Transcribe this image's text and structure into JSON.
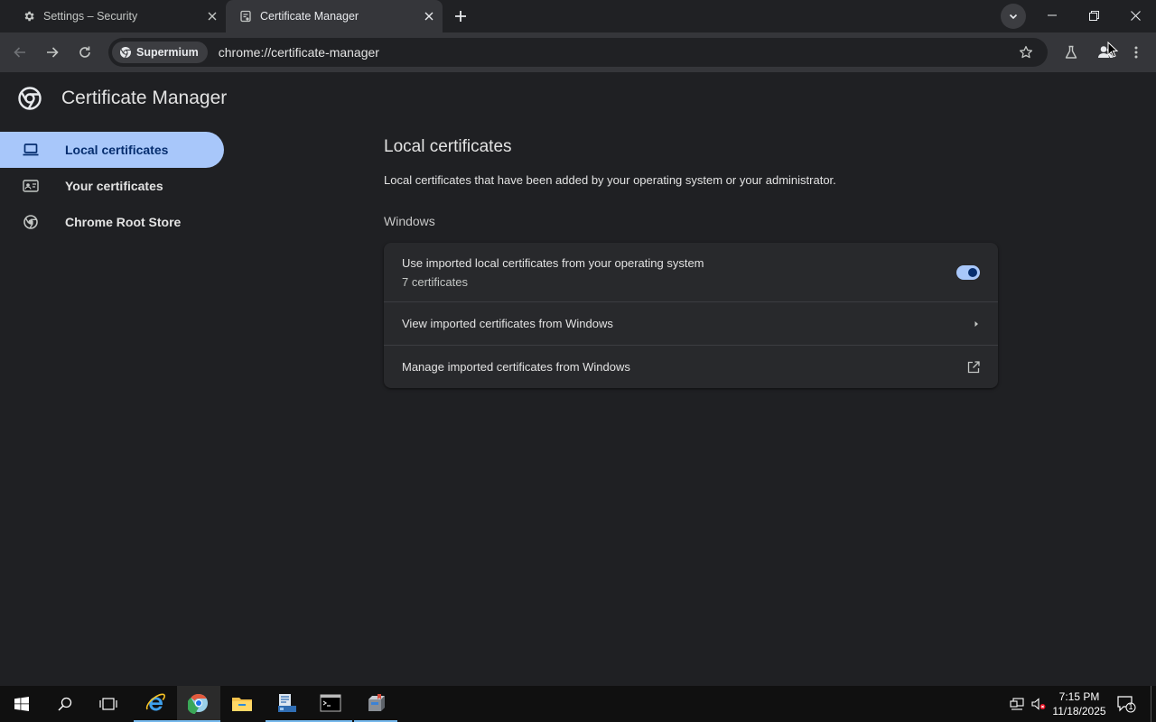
{
  "tabs": [
    {
      "title": "Settings – Security",
      "icon": "gear-icon"
    },
    {
      "title": "Certificate Manager",
      "icon": "certificate-icon",
      "active": true
    }
  ],
  "toolbar": {
    "chip_label": "Supermium",
    "url": "chrome://certificate-manager"
  },
  "page": {
    "app_title": "Certificate Manager",
    "sidebar": [
      {
        "label": "Local certificates",
        "icon": "laptop-icon",
        "active": true
      },
      {
        "label": "Your certificates",
        "icon": "id-card-icon"
      },
      {
        "label": "Chrome Root Store",
        "icon": "chrome-icon"
      }
    ],
    "main": {
      "heading": "Local certificates",
      "description": "Local certificates that have been added by your operating system or your administrator.",
      "section_label": "Windows",
      "rows": [
        {
          "label": "Use imported local certificates from your operating system",
          "sublabel": "7 certificates",
          "control": "toggle",
          "toggle_on": true
        },
        {
          "label": "View imported certificates from Windows",
          "control": "arrow-right-icon"
        },
        {
          "label": "Manage imported certificates from Windows",
          "control": "open-external-icon"
        }
      ]
    }
  },
  "taskbar": {
    "apps": [
      "start-icon",
      "search-icon",
      "task-view-icon",
      "internet-explorer-icon",
      "supermium-browser-icon",
      "file-explorer-icon",
      "server-manager-icon",
      "command-prompt-icon",
      "app-installer-icon"
    ],
    "time": "7:15 PM",
    "date": "11/18/2025",
    "notification_count": "1"
  },
  "colors": {
    "accent": "#a8c7fa",
    "page_bg": "#1f2023",
    "toolbar_bg": "#35363a",
    "tabstrip_bg": "#202124"
  }
}
